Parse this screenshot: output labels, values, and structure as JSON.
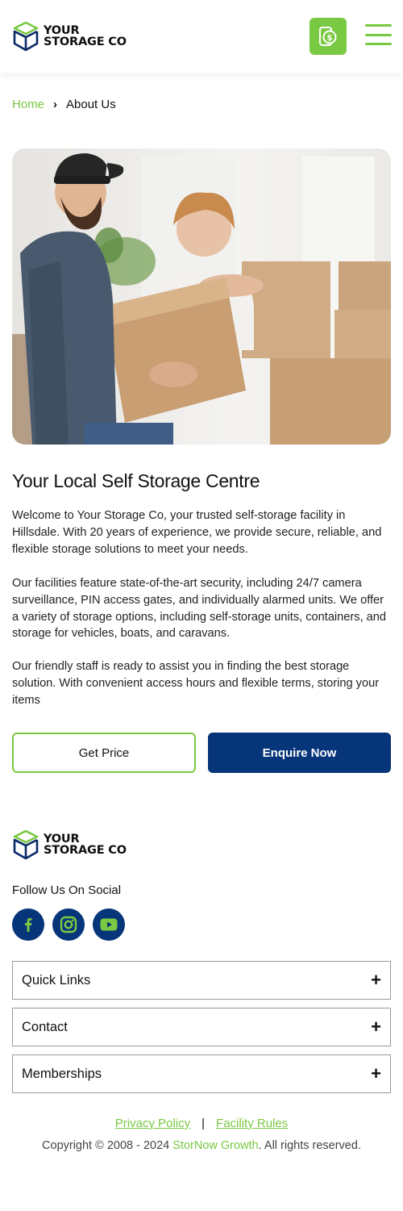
{
  "header": {
    "logo_line1": "YOUR",
    "logo_line2": "STORAGE CO"
  },
  "breadcrumb": {
    "home": "Home",
    "separator": "›",
    "current": "About Us"
  },
  "content": {
    "title": "Your Local Self Storage Centre",
    "paragraphs": [
      "Welcome to Your Storage Co, your trusted self-storage facility in Hillsdale. With 20 years of experience, we provide secure, reliable, and flexible storage solutions to meet your needs.",
      "Our facilities feature state-of-the-art security, including 24/7 camera surveillance, PIN access gates, and individually alarmed units. We offer a variety of storage options, including self-storage units, containers, and storage for vehicles, boats, and caravans.",
      "Our friendly staff is ready to assist you in finding the best storage solution. With convenient access hours and flexible terms, storing your items"
    ]
  },
  "buttons": {
    "get_price": "Get Price",
    "enquire_now": "Enquire Now"
  },
  "footer": {
    "logo_line1": "YOUR",
    "logo_line2": "STORAGE CO",
    "follow_label": "Follow Us On Social",
    "social_icons": [
      "facebook-icon",
      "instagram-icon",
      "youtube-icon"
    ],
    "accordions": [
      "Quick Links",
      "Contact",
      "Memberships"
    ],
    "accordion_toggle": "+",
    "links": {
      "privacy": "Privacy Policy",
      "divider": "|",
      "rules": "Facility Rules"
    },
    "copyright_prefix": "Copyright © 2008 - 2024 ",
    "copyright_brand": "StorNow Growth",
    "copyright_suffix": ". All rights reserved."
  },
  "colors": {
    "accent_green": "#7ac943",
    "brand_navy": "#06357a"
  }
}
